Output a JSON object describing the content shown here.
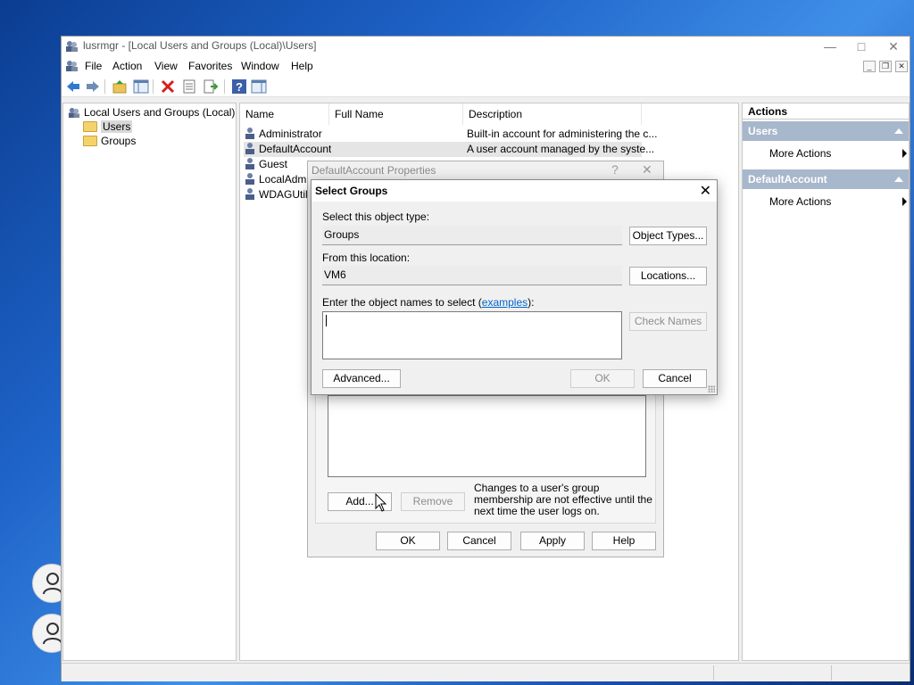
{
  "window": {
    "title": "lusrmgr - [Local Users and Groups (Local)\\Users]",
    "menu": [
      "File",
      "Action",
      "View",
      "Favorites",
      "Window",
      "Help"
    ]
  },
  "tree": {
    "root": "Local Users and Groups (Local)",
    "items": [
      "Users",
      "Groups"
    ]
  },
  "list": {
    "columns": [
      "Name",
      "Full Name",
      "Description"
    ],
    "rows": [
      {
        "name": "Administrator",
        "full_name": "",
        "description": "Built-in account for administering the c..."
      },
      {
        "name": "DefaultAccount",
        "full_name": "",
        "description": "A user account managed by the syste..."
      },
      {
        "name": "Guest",
        "full_name": "",
        "description": ""
      },
      {
        "name": "LocalAdmin",
        "full_name": "",
        "description": ""
      },
      {
        "name": "WDAGUtilit",
        "full_name": "",
        "description": ""
      }
    ]
  },
  "actions": {
    "header": "Actions",
    "sections": [
      {
        "title": "Users",
        "items": [
          "More Actions"
        ]
      },
      {
        "title": "DefaultAccount",
        "items": [
          "More Actions"
        ]
      }
    ]
  },
  "properties_dialog": {
    "title": "DefaultAccount Properties",
    "help": "?",
    "note": "Changes to a user's group membership are not effective until the next time the user logs on.",
    "buttons": {
      "add": "Add...",
      "remove": "Remove",
      "ok": "OK",
      "cancel": "Cancel",
      "apply": "Apply",
      "help": "Help"
    }
  },
  "select_groups": {
    "title": "Select Groups",
    "object_type_label": "Select this object type:",
    "object_type_value": "Groups",
    "object_types_button": "Object Types...",
    "location_label": "From this location:",
    "location_value": "VM6",
    "locations_button": "Locations...",
    "names_label_prefix": "Enter the object names to select (",
    "names_label_link": "examples",
    "names_label_suffix": "):",
    "names_value": "",
    "check_names_button": "Check Names",
    "advanced_button": "Advanced...",
    "ok_button": "OK",
    "cancel_button": "Cancel"
  },
  "colors": {
    "actions_section": "#a7b7cc",
    "link": "#0066cc"
  }
}
